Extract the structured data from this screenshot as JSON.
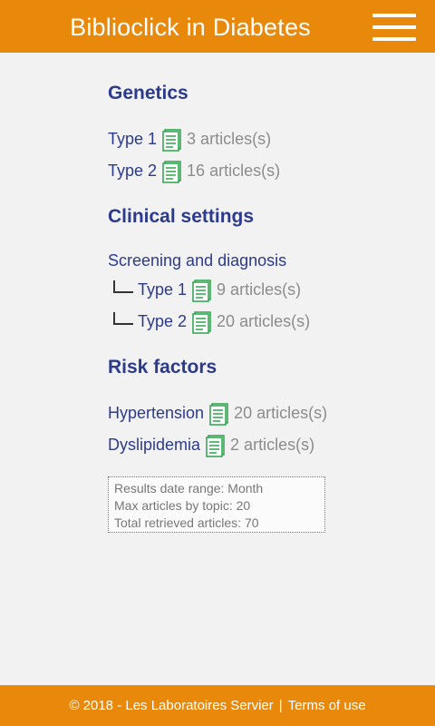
{
  "header": {
    "title": "Biblioclick in Diabetes",
    "menu_icon": "hamburger-menu-icon"
  },
  "colors": {
    "brand": "#e8890c",
    "heading": "#2c3a8c",
    "count": "#8c8c8c",
    "icon": "#2aa34a"
  },
  "sections": {
    "genetics": {
      "title": "Genetics",
      "items": [
        {
          "label": "Type 1",
          "count": "3 articles(s)"
        },
        {
          "label": "Type 2",
          "count": "16 articles(s)"
        }
      ]
    },
    "clinical": {
      "title": "Clinical settings",
      "subgroup": "Screening and diagnosis",
      "items": [
        {
          "label": "Type 1",
          "count": "9 articles(s)"
        },
        {
          "label": "Type 2",
          "count": "20 articles(s)"
        }
      ]
    },
    "risk": {
      "title": "Risk factors",
      "items": [
        {
          "label": "Hypertension",
          "count": "20 articles(s)"
        },
        {
          "label": "Dyslipidemia",
          "count": "2 articles(s)"
        }
      ]
    }
  },
  "info": {
    "date_range": "Results date range: Month",
    "max_articles": "Max articles by topic: 20",
    "total": "Total retrieved articles: 70"
  },
  "footer": {
    "copyright": "© 2018 - Les Laboratoires Servier",
    "separator": "|",
    "terms": "Terms of use"
  }
}
